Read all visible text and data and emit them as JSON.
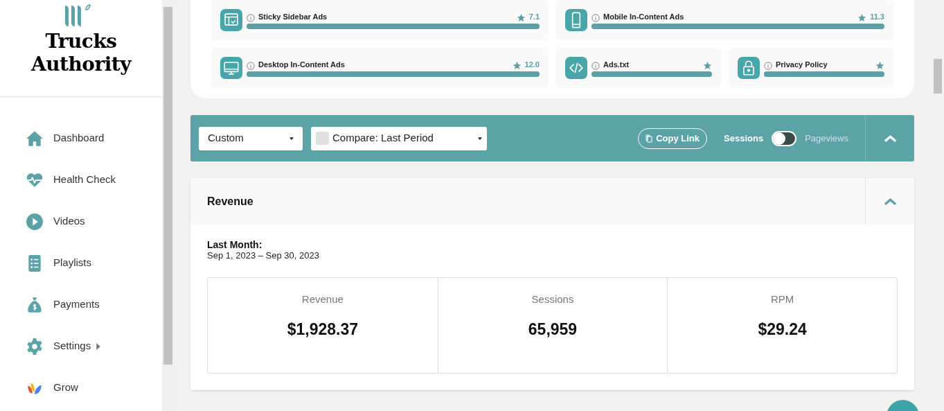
{
  "brand": {
    "name": "Trucks Authority"
  },
  "nav": [
    {
      "label": "Dashboard",
      "kind": "home",
      "submenu": false
    },
    {
      "label": "Health Check",
      "kind": "heart",
      "submenu": false
    },
    {
      "label": "Videos",
      "kind": "play",
      "submenu": false
    },
    {
      "label": "Playlists",
      "kind": "list",
      "submenu": false
    },
    {
      "label": "Payments",
      "kind": "bag",
      "submenu": false
    },
    {
      "label": "Settings",
      "kind": "gear",
      "submenu": true
    },
    {
      "label": "Grow",
      "kind": "grow",
      "submenu": false
    }
  ],
  "checks": [
    {
      "label": "Sticky Sidebar Ads",
      "kind": "window",
      "score": "7.1",
      "level": 1
    },
    {
      "label": "Mobile In-Content Ads",
      "kind": "mobile",
      "score": "11.3",
      "level": 1
    },
    {
      "label": "Desktop In-Content Ads",
      "kind": "desktop",
      "score": "12.0",
      "level": 1
    },
    {
      "label": "Ads.txt",
      "kind": "code",
      "level": 1
    },
    {
      "label": "Privacy Policy",
      "kind": "lock",
      "level": 1
    }
  ],
  "toolbar": {
    "range": "Custom",
    "compare": {
      "label": "Compare: Last Period",
      "checked": false
    },
    "copy_link": "Copy Link",
    "metric_options": [
      {
        "label": "Sessions",
        "selected": true
      },
      {
        "label": "Pageviews",
        "selected": false
      }
    ]
  },
  "revenue": {
    "title": "Revenue",
    "period_label": "Last Month:",
    "period": "Sep 1, 2023 – Sep 30, 2023",
    "stats": [
      {
        "label": "Revenue",
        "value": "$1,928.37"
      },
      {
        "label": "Sessions",
        "value": "65,959"
      },
      {
        "label": "RPM",
        "value": "$29.24"
      }
    ]
  }
}
